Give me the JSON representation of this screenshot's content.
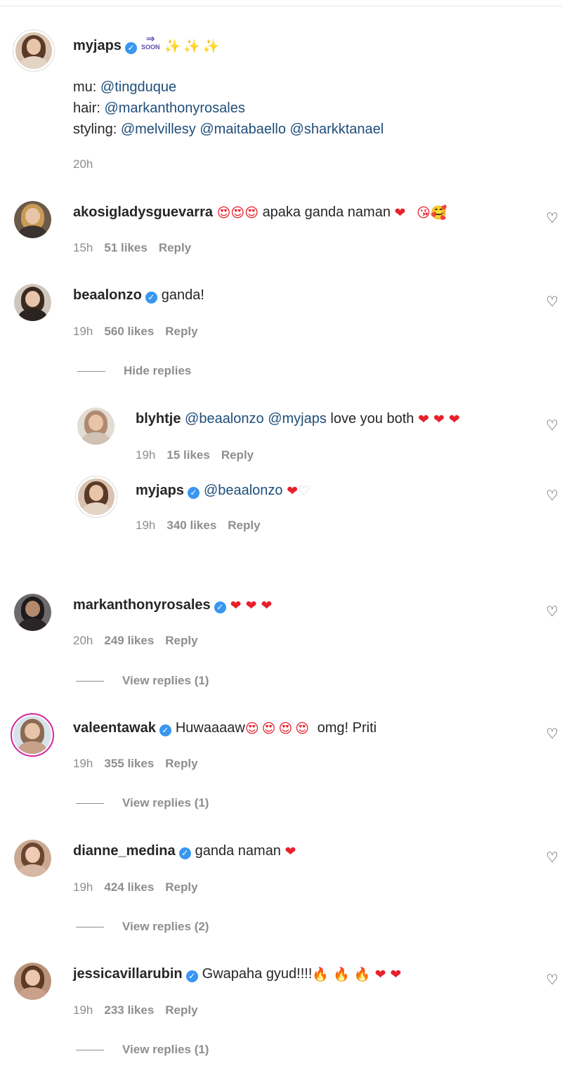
{
  "caption": {
    "username": "myjaps",
    "mu_label": "mu:",
    "mu_mention": "@tingduque",
    "hair_label": "hair:",
    "hair_mention": "@markanthonyrosales",
    "styling_label": "styling:",
    "styling_mentions": [
      "@melvillesy",
      "@maitabaello",
      "@sharkktanael"
    ],
    "soon_text": "SOON",
    "time": "20h"
  },
  "comments": [
    {
      "username": "akosigladysguevarra",
      "text": "apaka ganda naman",
      "time": "15h",
      "likes": "51 likes",
      "reply": "Reply"
    },
    {
      "username": "beaalonzo",
      "text": "ganda!",
      "time": "19h",
      "likes": "560 likes",
      "reply": "Reply",
      "toggle": "Hide replies"
    },
    {
      "username": "markanthonyrosales",
      "text": "",
      "time": "20h",
      "likes": "249 likes",
      "reply": "Reply",
      "toggle": "View replies (1)"
    },
    {
      "username": "valeentawak",
      "text_a": "Huwaaaaw",
      "text_b": "omg! Priti",
      "time": "19h",
      "likes": "355 likes",
      "reply": "Reply",
      "toggle": "View replies (1)"
    },
    {
      "username": "dianne_medina",
      "text": "ganda naman",
      "time": "19h",
      "likes": "424 likes",
      "reply": "Reply",
      "toggle": "View replies (2)"
    },
    {
      "username": "jessicavillarubin",
      "text": "Gwapaha gyud!!!!",
      "time": "19h",
      "likes": "233 likes",
      "reply": "Reply",
      "toggle": "View replies (1)"
    }
  ],
  "replies": [
    {
      "username": "blyhtje",
      "mention1": "@beaalonzo",
      "mention2": "@myjaps",
      "text": "love you both",
      "time": "19h",
      "likes": "15 likes",
      "reply": "Reply"
    },
    {
      "username": "myjaps",
      "mention1": "@beaalonzo",
      "time": "19h",
      "likes": "340 likes",
      "reply": "Reply"
    }
  ],
  "icons": {
    "verified": "verified-badge-icon",
    "like": "heart-outline-icon",
    "heart_emoji": "red-heart-emoji",
    "heart_eyes": "heart-eyes-emoji",
    "fire": "fire-emoji",
    "sparkles": "sparkles-emoji"
  },
  "colors": {
    "mention": "#1f4e79",
    "meta": "#8e8e8e",
    "verified": "#3897f0",
    "heart": "#e8202b"
  }
}
